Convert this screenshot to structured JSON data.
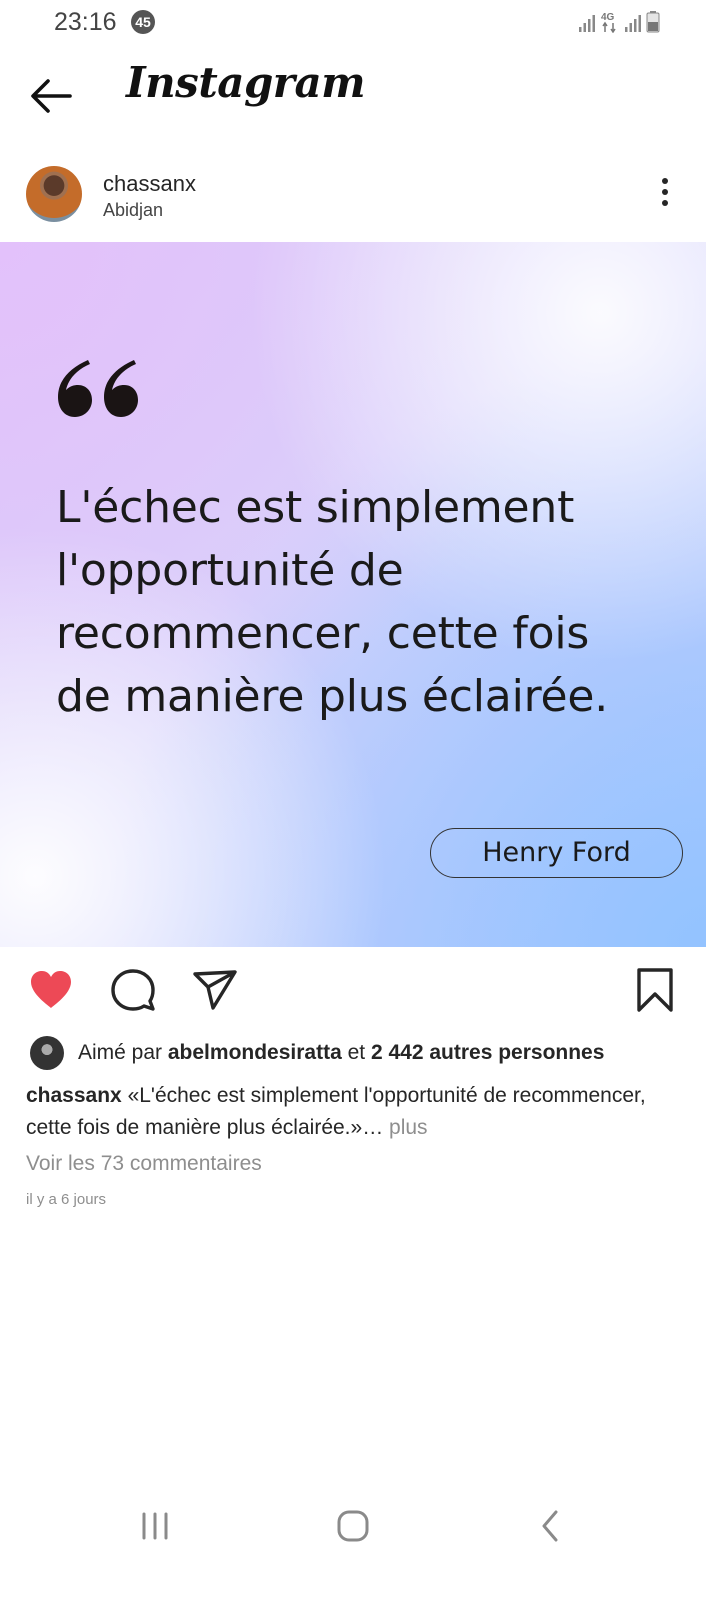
{
  "status_bar": {
    "time": "23:16",
    "notification_count": "45",
    "network_label": "4G"
  },
  "header": {
    "app_title": "Instagram",
    "back_icon": "arrow-left-icon"
  },
  "post": {
    "username": "chassanx",
    "location": "Abidjan",
    "image": {
      "quote": "L'échec est simplement l'opportunité de recommencer, cette fois de manière plus éclairée.",
      "quote_lines": [
        "L'échec est simplement",
        "l'opportunité de",
        "recommencer, cette fois",
        "de manière plus éclairée."
      ],
      "author": "Henry Ford"
    },
    "liked": true,
    "colors": {
      "like": "#ed4956",
      "secondary_text": "#8e8e8e",
      "primary_text": "#262626"
    },
    "likes": {
      "prefix": "Aimé par",
      "liker": "abelmondesiratta",
      "connector": "et",
      "others": "2 442 autres personnes"
    },
    "caption": {
      "username": "chassanx",
      "text": "«L'échec est simplement l'opportunité de recommencer, cette fois de manière plus éclairée.»",
      "ellipsis": "…",
      "more_label": "plus"
    },
    "comments_link": "Voir les 73 commentaires",
    "timestamp": "il y a 6 jours"
  },
  "nav_bar": {
    "items": [
      "recent-apps-icon",
      "home-icon",
      "back-icon"
    ]
  }
}
